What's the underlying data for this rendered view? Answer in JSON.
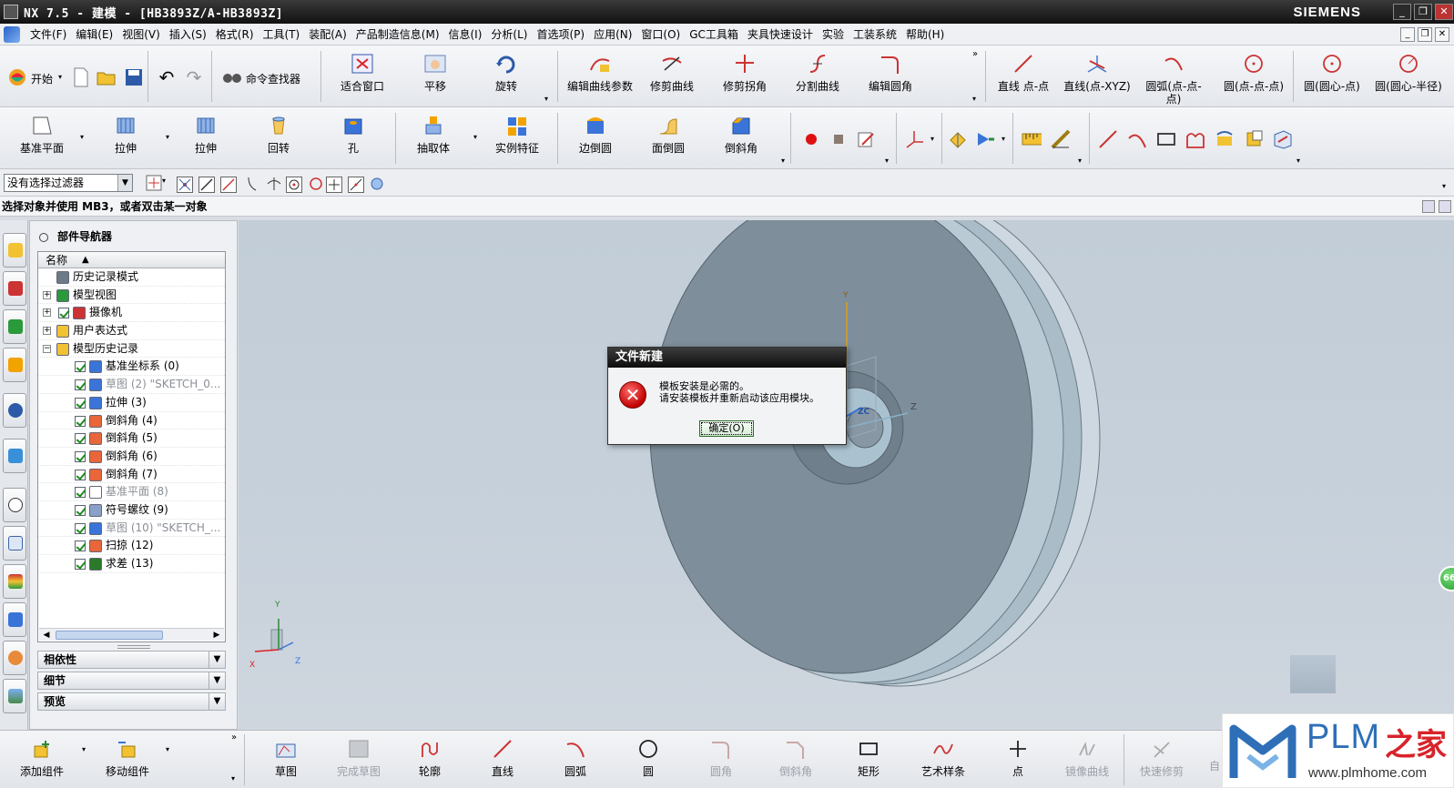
{
  "window": {
    "title": "NX 7.5 - 建模 - [HB3893Z/A-HB3893Z]",
    "brand": "SIEMENS",
    "minimize": "_",
    "restore": "❐",
    "close": "✕"
  },
  "menu": {
    "items": [
      "文件(F)",
      "编辑(E)",
      "视图(V)",
      "插入(S)",
      "格式(R)",
      "工具(T)",
      "装配(A)",
      "产品制造信息(M)",
      "信息(I)",
      "分析(L)",
      "首选项(P)",
      "应用(N)",
      "窗口(O)",
      "GC工具箱",
      "夹具快速设计",
      "实验",
      "工装系统",
      "帮助(H)"
    ]
  },
  "toolbar1": {
    "start": "开始",
    "command_finder": "命令查找器",
    "fit": "适合窗口",
    "pan": "平移",
    "rotate": "旋转",
    "edit_curve_params": "编辑曲线参数",
    "trim_curve": "修剪曲线",
    "trim_corner": "修剪拐角",
    "divide_curve": "分割曲线",
    "edit_fillet": "编辑圆角",
    "line_pt_pt": "直线 点-点",
    "line_pt_xyz": "直线(点-XYZ)",
    "arc_3pt": "圆弧(点-点-点)",
    "circle_3pt": "圆(点-点-点)",
    "circle_center_pt": "圆(圆心-点)",
    "circle_center_radius": "圆(圆心-半径)"
  },
  "toolbar2": {
    "datum_plane": "基准平面",
    "extrude1": "拉伸",
    "extrude2": "拉伸",
    "revolve": "回转",
    "hole": "孔",
    "extract_body": "抽取体",
    "instance_feature": "实例特征",
    "edge_blend": "边倒圆",
    "face_blend": "面倒圆",
    "chamfer": "倒斜角"
  },
  "filter": {
    "value": "没有选择过滤器"
  },
  "cue": {
    "text": "选择对象并使用 MB3，或者双击某一对象"
  },
  "navigator": {
    "title": "部件导航器",
    "column": "名称",
    "rows": [
      {
        "label": "历史记录模式",
        "level": 0,
        "exp": ""
      },
      {
        "label": "模型视图",
        "level": 0,
        "exp": "+"
      },
      {
        "label": "摄像机",
        "level": 0,
        "exp": "+"
      },
      {
        "label": "用户表达式",
        "level": 0,
        "exp": "+"
      },
      {
        "label": "模型历史记录",
        "level": 0,
        "exp": "−"
      },
      {
        "label": "基准坐标系 (0)",
        "level": 1
      },
      {
        "label": "草图 (2) \"SKETCH_0...",
        "level": 1,
        "gray": true
      },
      {
        "label": "拉伸 (3)",
        "level": 1
      },
      {
        "label": "倒斜角 (4)",
        "level": 1
      },
      {
        "label": "倒斜角 (5)",
        "level": 1
      },
      {
        "label": "倒斜角 (6)",
        "level": 1
      },
      {
        "label": "倒斜角 (7)",
        "level": 1
      },
      {
        "label": "基准平面 (8)",
        "level": 1,
        "gray": true
      },
      {
        "label": "符号螺纹 (9)",
        "level": 1
      },
      {
        "label": "草图 (10) \"SKETCH_...",
        "level": 1,
        "gray": true
      },
      {
        "label": "扫掠 (12)",
        "level": 1
      },
      {
        "label": "求差 (13)",
        "level": 1
      }
    ],
    "sections": [
      "相依性",
      "细节",
      "预览"
    ]
  },
  "dialog": {
    "title": "文件新建",
    "line1": "模板安装是必需的。",
    "line2": "请安装模板并重新启动该应用模块。",
    "ok": "确定(O)"
  },
  "bottom": {
    "add_component": "添加组件",
    "move_component": "移动组件",
    "sketch": "草图",
    "finish_sketch": "完成草图",
    "profile": "轮廓",
    "line": "直线",
    "arc": "圆弧",
    "circle": "圆",
    "fillet": "圆角",
    "chamfer": "倒斜角",
    "rectangle": "矩形",
    "studio_spline": "艺术样条",
    "point": "点",
    "mirror_curve": "镜像曲线",
    "quick_trim": "快速修剪",
    "auto": "自"
  },
  "axes": {
    "x": "X",
    "y": "Y",
    "z": "Z",
    "zc": "ZC",
    "y_small": "Y"
  },
  "watermark": {
    "plm": "PLM",
    "home": "之家",
    "url": "www.plmhome.com"
  },
  "badge": "66",
  "colors": {
    "part": "#7e8f9b",
    "rim": "#b4c6d2",
    "accent_red": "#d8232a",
    "accent_blue": "#2e6fb7"
  }
}
